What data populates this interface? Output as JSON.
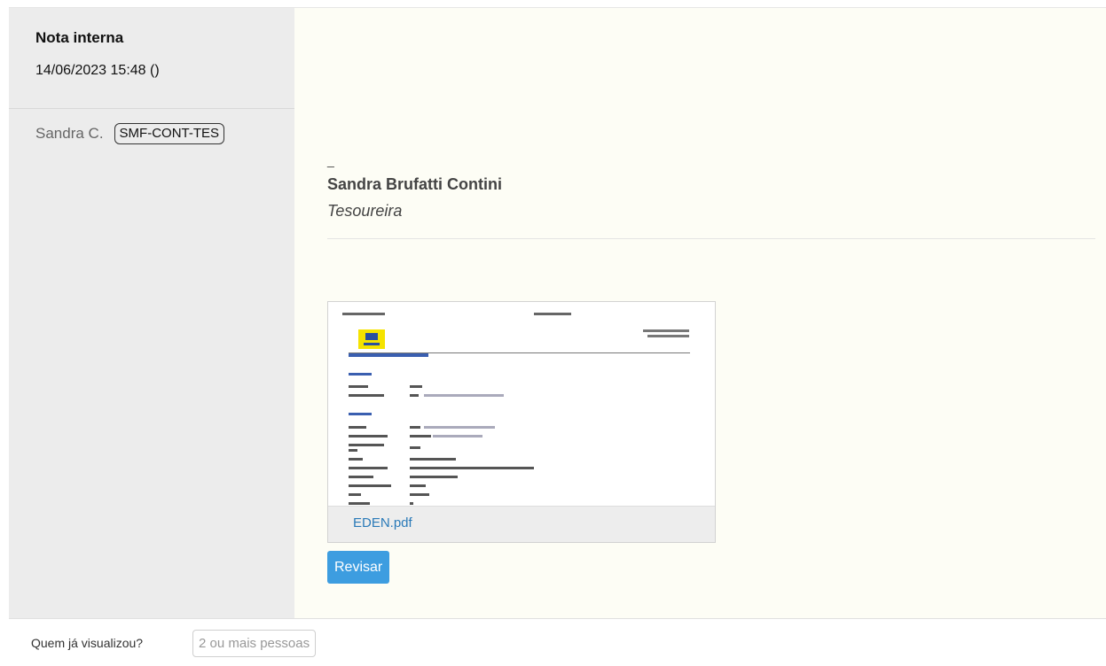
{
  "note": {
    "title": "Nota interna",
    "datetime": "14/06/2023 15:48 ()",
    "author": "Sandra C.",
    "department": "SMF-CONT-TES"
  },
  "signature": {
    "dash": "_",
    "name": "Sandra Brufatti Contini",
    "role": "Tesoureira"
  },
  "attachment": {
    "filename": "EDEN.pdf"
  },
  "actions": {
    "review_label": "Revisar"
  },
  "footer": {
    "viewed_question": "Quem já visualizou?",
    "viewed_button": "2 ou mais pessoas"
  },
  "colors": {
    "sidebar_bg": "#ececec",
    "content_bg": "#fdfdf5",
    "accent": "#3d9de0",
    "link": "#2a7ab8"
  }
}
